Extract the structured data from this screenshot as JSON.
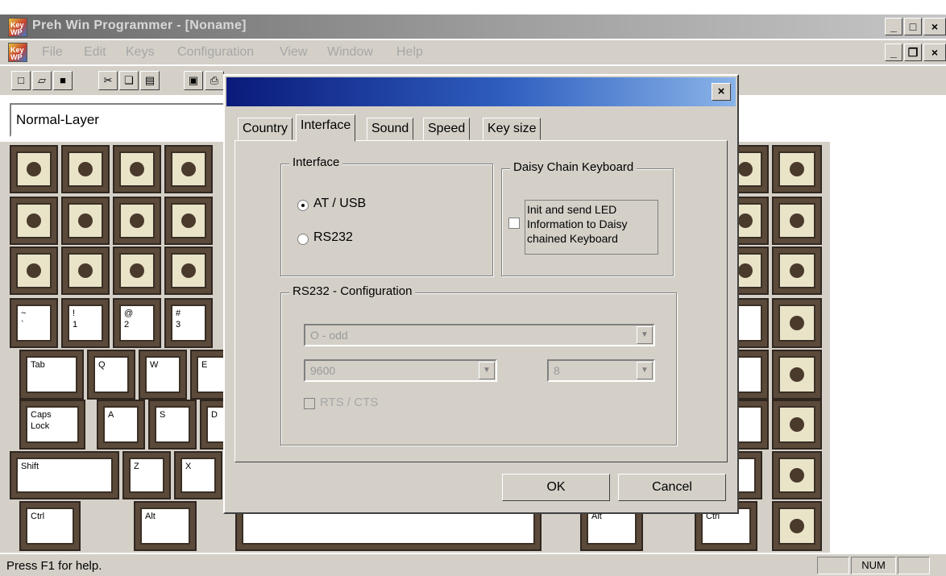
{
  "window": {
    "title": "Preh Win Programmer - [Noname]"
  },
  "menu": [
    "File",
    "Edit",
    "Keys",
    "Configuration",
    "View",
    "Window",
    "Help"
  ],
  "layer": {
    "value": "Normal-Layer"
  },
  "keys": {
    "row4": [
      "~\n`",
      "!\n1",
      "@\n2",
      "#\n3"
    ],
    "tab": "Tab",
    "q": "Q",
    "w": "W",
    "e": "E",
    "caps": "Caps\nLock",
    "a": "A",
    "s": "S",
    "d": "D",
    "shift": "Shift",
    "z": "Z",
    "x": "X",
    "ctrl": "Ctrl",
    "alt_left": "Alt",
    "alt_right": "Alt",
    "ctrl_right": "Ctrl"
  },
  "dialog": {
    "tabs": [
      "Country",
      "Interface",
      "Sound",
      "Speed",
      "Key size"
    ],
    "active_tab": "Interface",
    "interface_group": "Interface",
    "radio_at_usb": "AT / USB",
    "radio_rs232": "RS232",
    "daisy_group": "Daisy Chain Keyboard",
    "daisy_checkbox": "Init and send LED Information to Daisy chained Keyboard",
    "rs232_group": "RS232 - Configuration",
    "parity": "O - odd",
    "baud": "9600",
    "bits": "8",
    "rts_cts": "RTS / CTS",
    "ok": "OK",
    "cancel": "Cancel"
  },
  "status": {
    "text": "Press F1 for help.",
    "num": "NUM"
  }
}
